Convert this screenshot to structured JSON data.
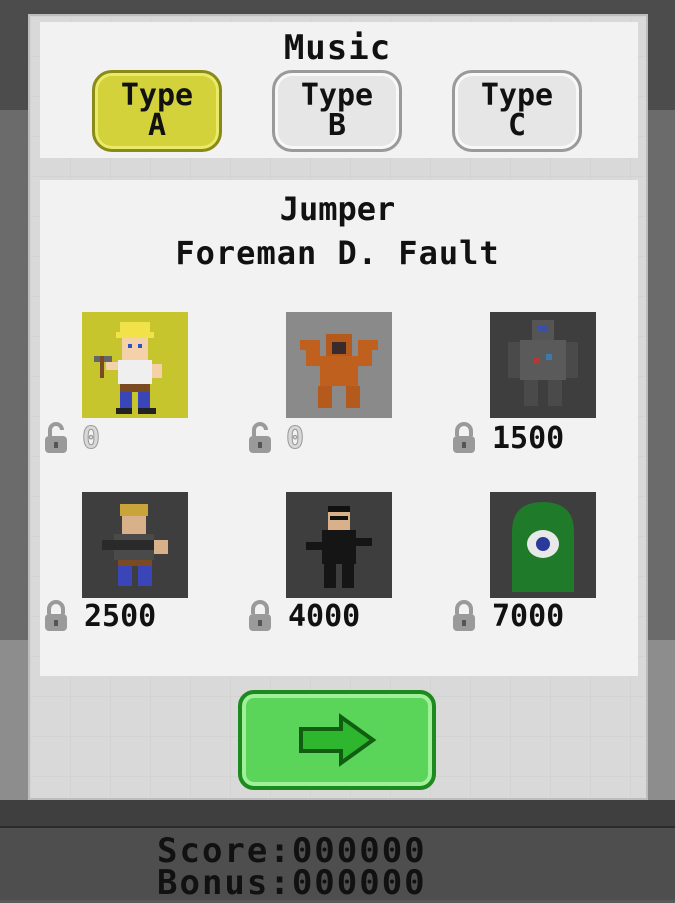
{
  "music": {
    "title": "Music",
    "types": [
      {
        "word": "Type",
        "letter": "A",
        "selected": true
      },
      {
        "word": "Type",
        "letter": "B",
        "selected": false
      },
      {
        "word": "Type",
        "letter": "C",
        "selected": false
      }
    ]
  },
  "character": {
    "role": "Jumper",
    "name": "Foreman D. Fault"
  },
  "characters": [
    {
      "icon": "foreman-character-icon",
      "price": "0",
      "unlocked": true,
      "selected": true
    },
    {
      "icon": "orangutan-character-icon",
      "price": "0",
      "unlocked": true,
      "selected": false
    },
    {
      "icon": "robot-character-icon",
      "price": "1500",
      "unlocked": false,
      "selected": false
    },
    {
      "icon": "worker-with-gun-character-icon",
      "price": "2500",
      "unlocked": false,
      "selected": false
    },
    {
      "icon": "agent-in-black-character-icon",
      "price": "4000",
      "unlocked": false,
      "selected": false
    },
    {
      "icon": "green-blob-character-icon",
      "price": "7000",
      "unlocked": false,
      "selected": false
    }
  ],
  "next_button": {
    "icon": "right-arrow-icon"
  },
  "score": {
    "score_label": "Score:",
    "score_value": "000000",
    "bonus_label": "Bonus:",
    "bonus_value": "000000"
  },
  "colors": {
    "selected_slot": "#c7c52d",
    "next_button": "#5bd45a",
    "type_selected": "#d4d23a"
  }
}
